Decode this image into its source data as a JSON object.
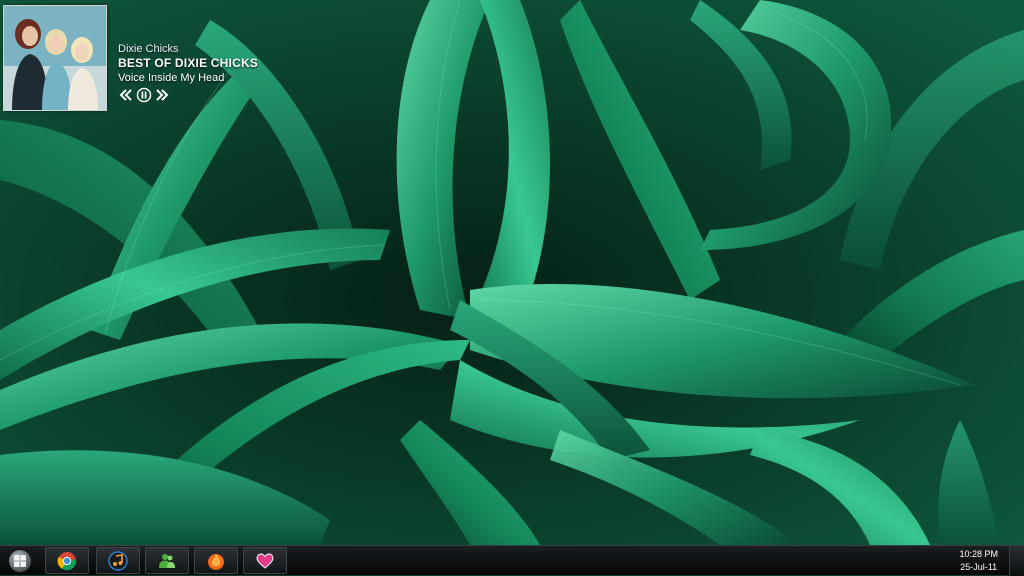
{
  "media_widget": {
    "artist": "Dixie Chicks",
    "album": "BEST OF DIXIE CHICKS",
    "track": "Voice Inside My Head",
    "controls": [
      {
        "icon": "previous-icon"
      },
      {
        "icon": "pause-icon"
      },
      {
        "icon": "next-icon"
      }
    ]
  },
  "taskbar": {
    "start_icon": "windows-logo-icon",
    "pinned_apps": [
      {
        "icon": "chrome-icon",
        "color": "#3a8fd8"
      },
      {
        "icon": "music-note-icon",
        "color": "#f0a030"
      },
      {
        "icon": "messenger-icon",
        "color": "#4caf3a"
      },
      {
        "icon": "fire-icon",
        "color": "#f26a1b"
      },
      {
        "icon": "heart-icon",
        "color": "#e83c8a"
      }
    ],
    "clock": {
      "time": "10:28 PM",
      "date": "25-Jul-11"
    }
  },
  "colors": {
    "leaf_dark": "#083a28",
    "leaf_mid": "#1f9a6a",
    "leaf_light": "#5fd8a6",
    "taskbar": "#0a0c0d"
  }
}
